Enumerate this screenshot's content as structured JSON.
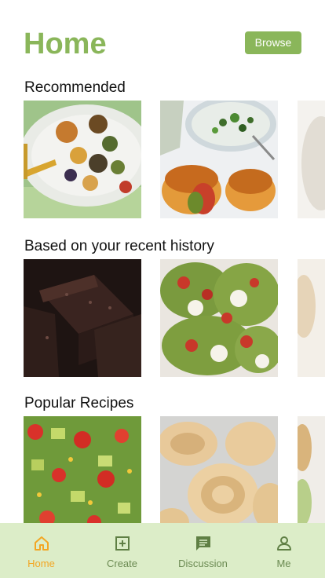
{
  "header": {
    "title": "Home",
    "browse_label": "Browse"
  },
  "sections": [
    {
      "title": "Recommended",
      "tiles": [
        "roasted-vegetables-chicken-icon",
        "burger-salad-icon",
        "partial-dish-icon"
      ]
    },
    {
      "title": "Based on your recent history",
      "tiles": [
        "brownies-icon",
        "avocado-toast-icon",
        "partial-dish-icon"
      ]
    },
    {
      "title": "Popular Recipes",
      "tiles": [
        "avocado-salad-icon",
        "fresh-pasta-icon",
        "partial-dish-icon"
      ]
    }
  ],
  "nav": [
    {
      "label": "Home",
      "icon": "home-icon",
      "active": true
    },
    {
      "label": "Create",
      "icon": "plus-square-icon",
      "active": false
    },
    {
      "label": "Discussion",
      "icon": "message-icon",
      "active": false
    },
    {
      "label": "Me",
      "icon": "person-icon",
      "active": false
    }
  ],
  "colors": {
    "accent": "#8ab65a",
    "nav_bg": "#dcedc8",
    "active": "#f3a623",
    "inactive": "#6b8a52"
  }
}
